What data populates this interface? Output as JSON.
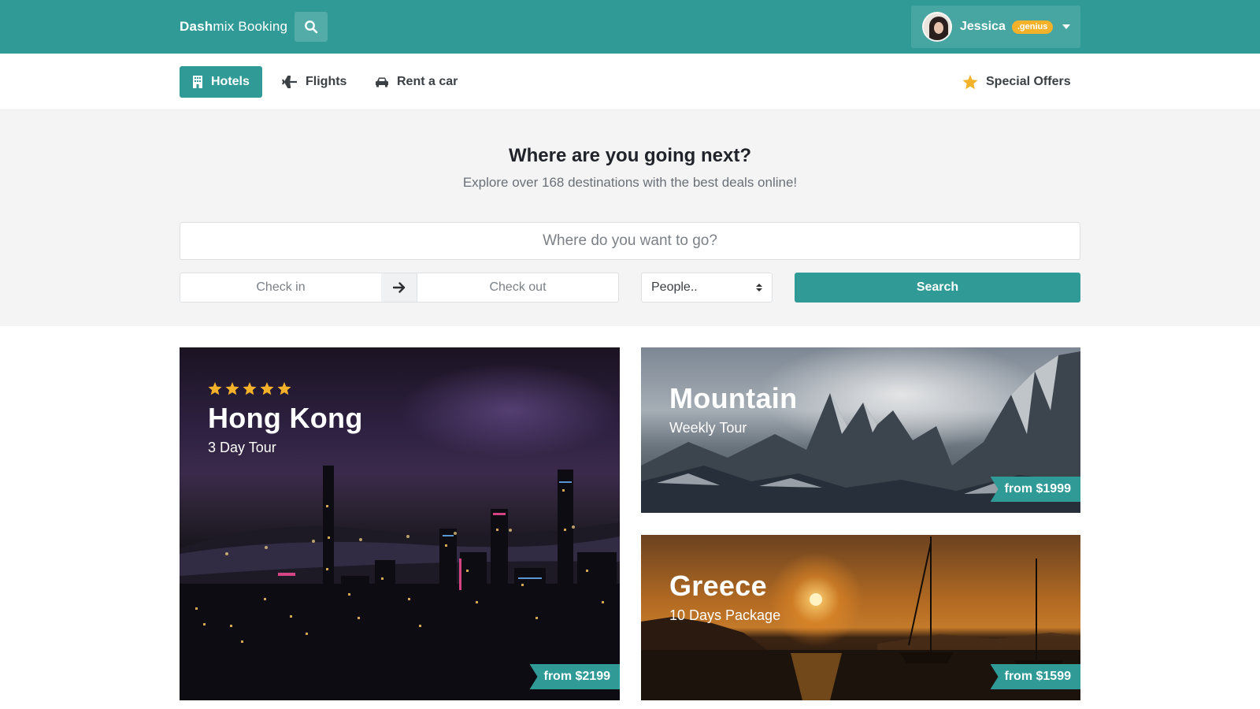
{
  "header": {
    "brand_bold": "Dash",
    "brand_rest": "mix Booking",
    "user": {
      "name": "Jessica",
      "badge": ".genius"
    }
  },
  "nav": {
    "items": [
      {
        "label": "Hotels",
        "icon": "hotel-icon",
        "active": true
      },
      {
        "label": "Flights",
        "icon": "plane-icon",
        "active": false
      },
      {
        "label": "Rent a car",
        "icon": "car-icon",
        "active": false
      }
    ],
    "special": {
      "label": "Special Offers",
      "icon": "star-icon"
    }
  },
  "hero": {
    "title": "Where are you going next?",
    "subtitle": "Explore over 168 destinations with the best deals online!",
    "destination_placeholder": "Where do you want to go?",
    "checkin_placeholder": "Check in",
    "checkout_placeholder": "Check out",
    "people_selected": "People..",
    "search_label": "Search"
  },
  "cards": [
    {
      "title": "Hong Kong",
      "subtitle": "3 Day Tour",
      "price": "from $2199",
      "rating": 5
    },
    {
      "title": "Mountain",
      "subtitle": "Weekly Tour",
      "price": "from $1999"
    },
    {
      "title": "Greece",
      "subtitle": "10 Days Package",
      "price": "from $1599"
    }
  ],
  "colors": {
    "primary": "#2f9a96",
    "badge": "#f3b22a",
    "star": "#f3b22a",
    "hero_bg": "#f4f4f4"
  }
}
